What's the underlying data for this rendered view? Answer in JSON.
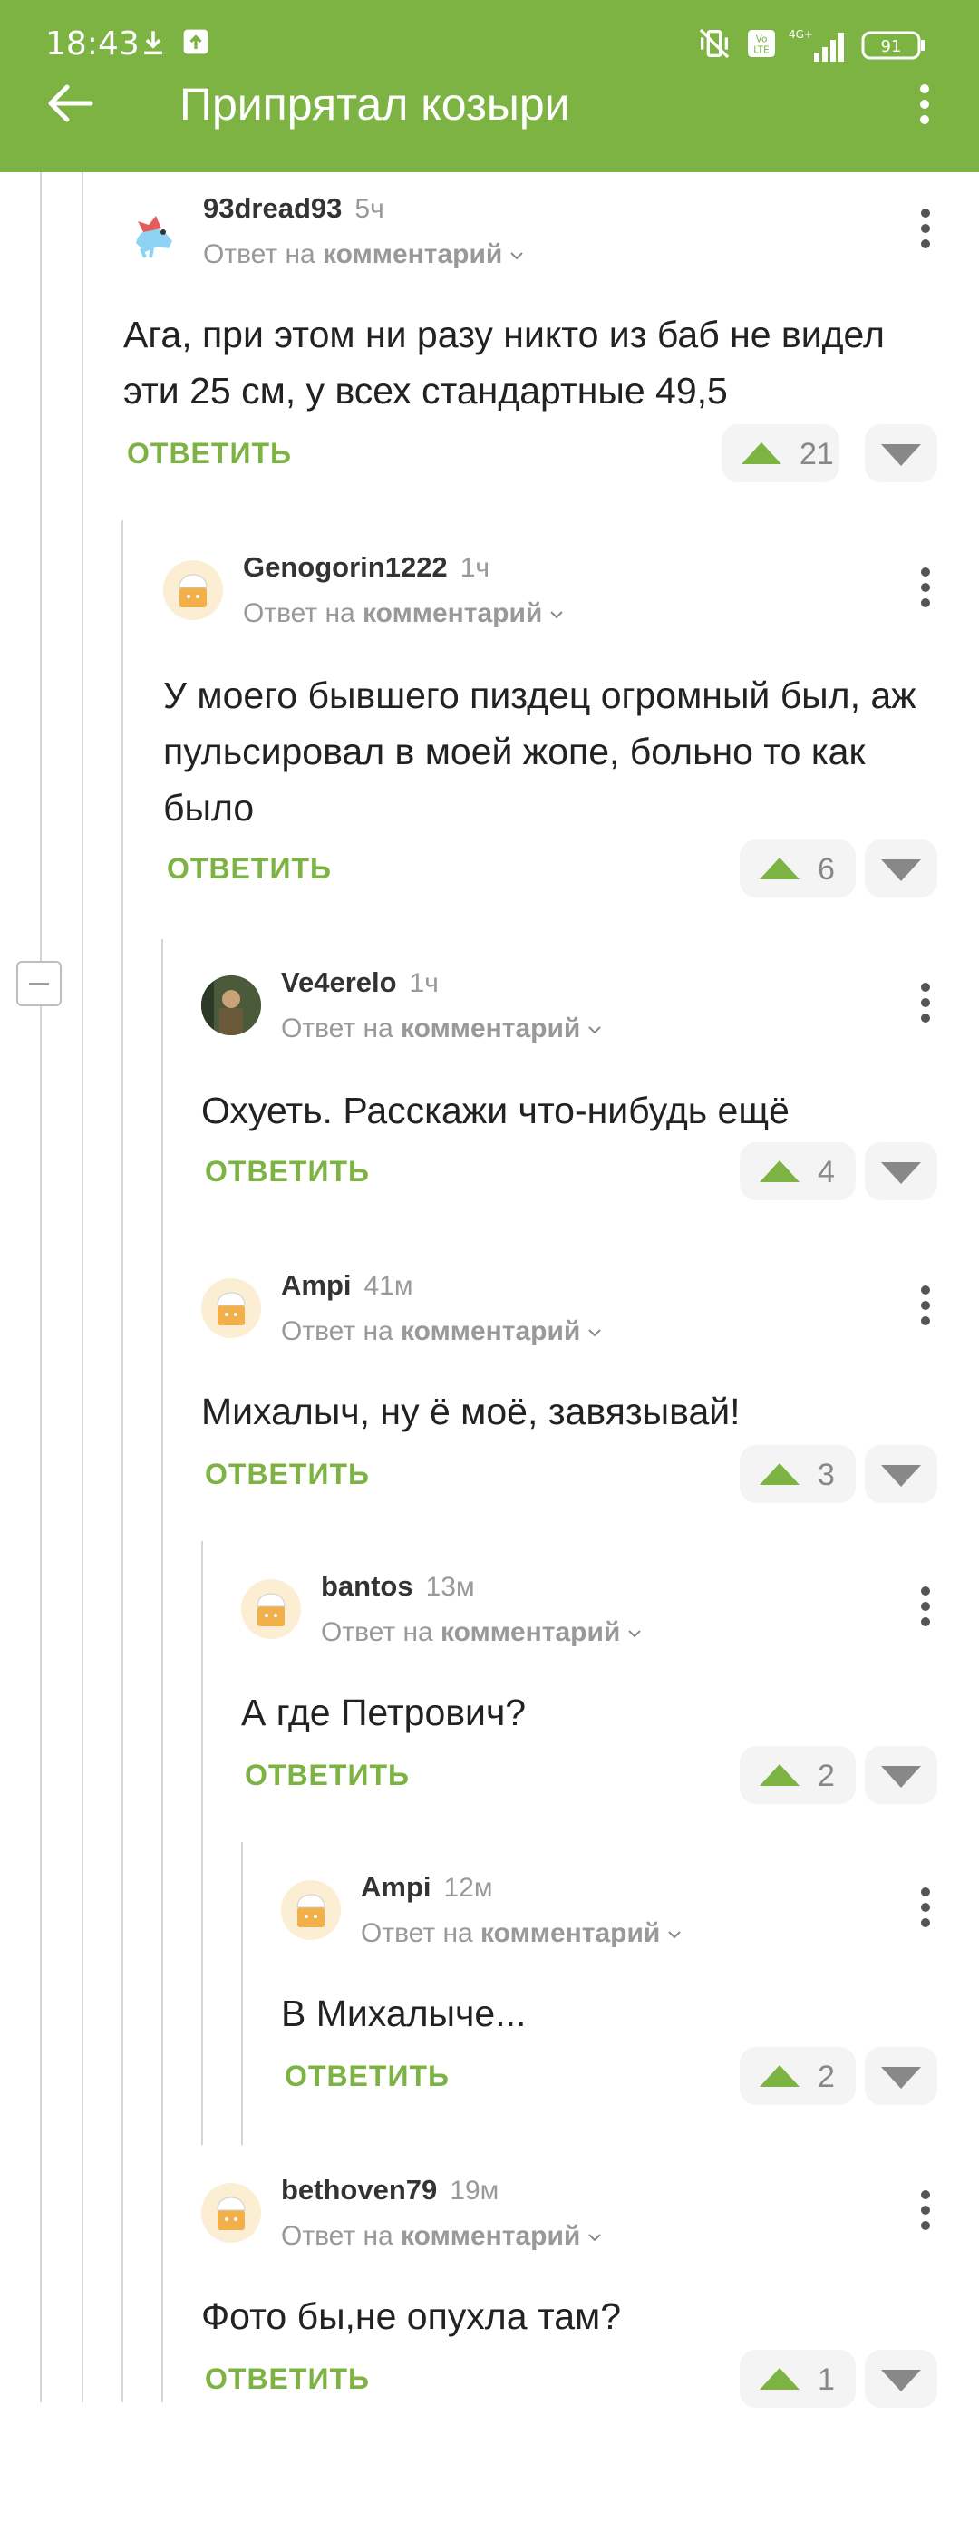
{
  "status_bar": {
    "time": "18:43",
    "network": "4G+",
    "battery": "91",
    "icons": [
      "download-icon",
      "upload-icon",
      "vibrate-off-icon",
      "volte-icon",
      "signal-icon",
      "battery-icon"
    ]
  },
  "header": {
    "title": "Припрятал козыри",
    "back_icon": "arrow-left-icon",
    "menu_icon": "more-vertical-icon"
  },
  "colors": {
    "accent": "#7cb342",
    "muted": "#999999",
    "pill_bg": "#f4f4f4"
  },
  "comments": [
    {
      "user": "93dread93",
      "time": "5ч",
      "reply_prefix": "Ответ на",
      "reply_target": "комментарий",
      "text": "Ага, при этом ни разу никто из баб не видел эти 25 см, у всех стандартные 49,5",
      "reply_label": "ОТВЕТИТЬ",
      "votes": "21"
    },
    {
      "user": "Genogorin1222",
      "time": "1ч",
      "reply_prefix": "Ответ на",
      "reply_target": "комментарий",
      "text": "У моего бывшего пиздец огромный был, аж пульсировал в моей жопе, больно то как было",
      "reply_label": "ОТВЕТИТЬ",
      "votes": "6"
    },
    {
      "user": "Ve4erelo",
      "time": "1ч",
      "reply_prefix": "Ответ на",
      "reply_target": "комментарий",
      "text": "Охуеть. Расскажи что-нибудь ещё",
      "reply_label": "ОТВЕТИТЬ",
      "votes": "4"
    },
    {
      "user": "Ampi",
      "time": "41м",
      "reply_prefix": "Ответ на",
      "reply_target": "комментарий",
      "text": "Михалыч, ну ё моё, завязывай!",
      "reply_label": "ОТВЕТИТЬ",
      "votes": "3"
    },
    {
      "user": "bantos",
      "time": "13м",
      "reply_prefix": "Ответ на",
      "reply_target": "комментарий",
      "text": "А где Петрович?",
      "reply_label": "ОТВЕТИТЬ",
      "votes": "2"
    },
    {
      "user": "Ampi",
      "time": "12м",
      "reply_prefix": "Ответ на",
      "reply_target": "комментарий",
      "text": "В Михалыче...",
      "reply_label": "ОТВЕТИТЬ",
      "votes": "2"
    },
    {
      "user": "bethoven79",
      "time": "19м",
      "reply_prefix": "Ответ на",
      "reply_target": "комментарий",
      "text": "Фото бы,не опухла там?",
      "reply_label": "ОТВЕТИТЬ",
      "votes": "1"
    }
  ]
}
